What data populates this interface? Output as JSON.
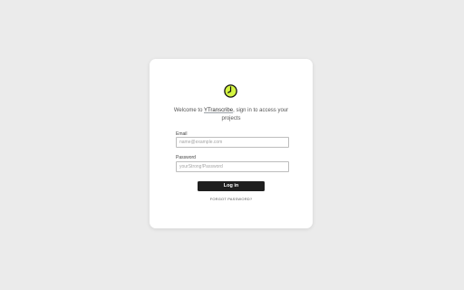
{
  "login": {
    "welcome_prefix": "Welcome to ",
    "app_name": "YTranscribe",
    "welcome_suffix": ", sign in to access your projects",
    "email_label": "Email",
    "email_placeholder": "name@example.com",
    "email_value": "",
    "password_label": "Password",
    "password_placeholder": "yourStrong!Password",
    "password_value": "",
    "login_button": "Log in",
    "forgot_password": "FORGOT PASSWORD?"
  },
  "logo": {
    "icon": "clock-icon",
    "fill_color": "#d4f542",
    "stroke_color": "#111111"
  },
  "colors": {
    "background": "#ebebeb",
    "card": "#ffffff",
    "button": "#1f1f1f"
  }
}
